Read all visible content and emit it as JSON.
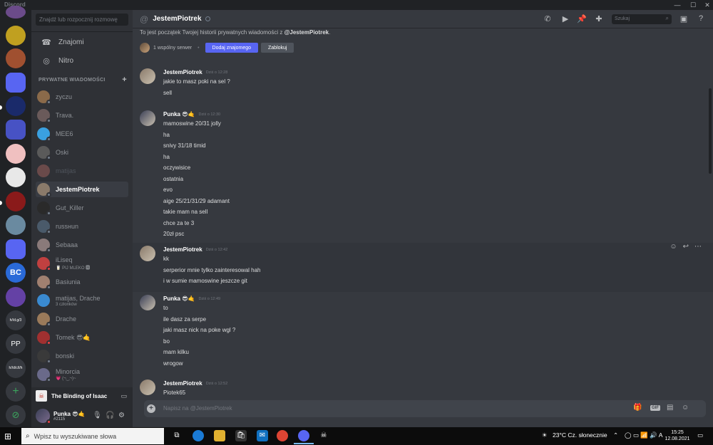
{
  "window": {
    "app_title": "Discord",
    "controls": [
      "minimize",
      "maximize",
      "close"
    ]
  },
  "rail": {
    "servers": [
      {
        "label": "",
        "color": "#6b4b8a"
      },
      {
        "label": "",
        "color": "#c0a020"
      },
      {
        "label": "",
        "color": "#a05030"
      },
      {
        "label": "",
        "color": "#5865f2"
      },
      {
        "label": "",
        "color": "#1a2a6a"
      },
      {
        "label": "",
        "color": "#4752c4"
      },
      {
        "label": "",
        "color": "#f0c0c0"
      },
      {
        "label": "",
        "color": "#e8e8e8"
      },
      {
        "label": "",
        "color": "#8a1a1a"
      },
      {
        "label": "",
        "color": "#6a8aa0"
      },
      {
        "label": "",
        "color": "#5865f2"
      },
      {
        "label": "BC",
        "color": "#2a6ad8"
      },
      {
        "label": "",
        "color": "#6441a5"
      },
      {
        "label": "h//d.g/3",
        "color": "#36393f"
      },
      {
        "label": "PP",
        "color": "#36393f"
      },
      {
        "label": "h//d/c/l/h",
        "color": "#36393f"
      }
    ],
    "add_label": "+",
    "explore_label": "⊘"
  },
  "dm_sidebar": {
    "search_placeholder": "Znajdź lub rozpocznij rozmowę",
    "nav": [
      {
        "label": "Znajomi"
      },
      {
        "label": "Nitro"
      }
    ],
    "section_title": "PRYWATNE WIADOMOŚCI",
    "section_add": "+",
    "dms": [
      {
        "name": "zyczu",
        "sub": "",
        "status": "offline",
        "color": "#8a6a4a"
      },
      {
        "name": "Trava.",
        "sub": "",
        "status": "offline",
        "color": "#6a5a5a"
      },
      {
        "name": "MEE6",
        "sub": "",
        "status": "offline",
        "color": "#3aa0e0"
      },
      {
        "name": "Oski",
        "sub": "",
        "status": "offline",
        "color": "#5a5a5a"
      },
      {
        "name": "matijas",
        "sub": "",
        "status": "muted",
        "color": "#6a4a4a"
      },
      {
        "name": "JestemPiotrek",
        "sub": "",
        "status": "offline",
        "color": "#8a7a6a"
      },
      {
        "name": "Gut_Killer",
        "sub": "",
        "status": "offline",
        "color": "#2a2a2a"
      },
      {
        "name": "russнun",
        "sub": "",
        "status": "offline",
        "color": "#4a5a6a"
      },
      {
        "name": "Sebaaa",
        "sub": "",
        "status": "offline",
        "color": "#8a7a7a"
      },
      {
        "name": "iLiseq",
        "sub": "🥛 PIJ MLEKO 🅼",
        "status": "dnd",
        "color": "#c04040"
      },
      {
        "name": "Basiunia",
        "sub": "",
        "status": "offline",
        "color": "#a08070"
      },
      {
        "name": "matijas, Drache",
        "sub": "3 członków",
        "status": "group",
        "color": "#3a8ad0"
      },
      {
        "name": "Drache",
        "sub": "",
        "status": "offline",
        "color": "#9a7a5a"
      },
      {
        "name": "Tomek 😎🤙",
        "sub": "",
        "status": "dnd",
        "color": "#a03030"
      },
      {
        "name": "bonski",
        "sub": "",
        "status": "offline",
        "color": "#3a3a3a"
      },
      {
        "name": "Minorcia",
        "sub": "💗 (¬‿¬)~",
        "status": "offline",
        "color": "#6a6a8a"
      }
    ],
    "active_index": 5,
    "now_playing": {
      "game": "The Binding of Isaac"
    },
    "user": {
      "name": "Punka 😎🤙",
      "tag": "#2115"
    }
  },
  "header": {
    "channel_name": "JestemPiotrek",
    "search_placeholder": "Szukaj"
  },
  "intro": {
    "text_prefix": "To jest początek Twojej historii prywatnych wiadomości z ",
    "mention": "@JestemPiotrek",
    "text_suffix": ".",
    "mutual": "1 wspólny serwer",
    "add_friend": "Dodaj znajomego",
    "block": "Zablokuj"
  },
  "messages": [
    {
      "author": "JestemPiotrek",
      "time": "Dziś o 12:28",
      "avatar_color": "#8a7a6a",
      "lines": [
        "jakie to masz poki na sel ?",
        "sell"
      ]
    },
    {
      "author": "Punka 😎🤙",
      "time": "Dziś o 12:30",
      "avatar_color": "#3a3f56",
      "lines": [
        "mamoswine 20/31 jolly",
        "ha",
        "snivy 31/18 timid",
        "ha",
        "oczywisice",
        "ostatnia",
        "evo",
        "aige 25/21/31/29 adamant",
        "takie mam na sell",
        "chce za te 3",
        "20zł psc"
      ]
    },
    {
      "author": "JestemPiotrek",
      "time": "Dziś o 12:42",
      "avatar_color": "#8a7a6a",
      "lines": [
        "kk",
        "serperior mnie tylko zainteresowal hah",
        "i w sumie mamoswine jeszcze git"
      ]
    },
    {
      "author": "Punka 😎🤙",
      "time": "Dziś o 12:49",
      "avatar_color": "#3a3f56",
      "lines": [
        "to",
        "ile dasz za serpe",
        "jaki masz nick na poke wgl ?",
        "bo",
        "mam kilku",
        "wrogow"
      ]
    },
    {
      "author": "JestemPiotrek",
      "time": "Dziś o 12:52",
      "avatar_color": "#8a7a6a",
      "lines": [
        "Piotek65"
      ]
    }
  ],
  "composer": {
    "placeholder": "Napisz na @JestemPiotrek",
    "gif_label": "GIF"
  },
  "taskbar": {
    "search_placeholder": "Wpisz tu wyszukiwane słowa",
    "weather": "23°C  Cz. słonecznie",
    "time": "15:25",
    "date": "12.08.2021"
  }
}
